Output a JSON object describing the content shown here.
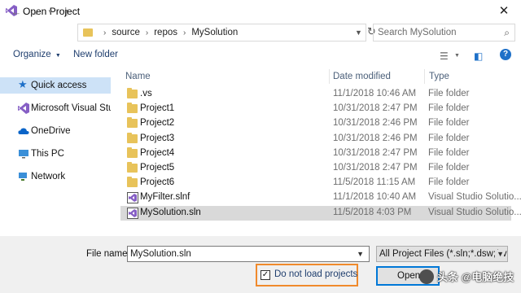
{
  "window": {
    "title": "Open Project"
  },
  "nav": {
    "breadcrumbs": [
      "source",
      "repos",
      "MySolution"
    ],
    "search_placeholder": "Search MySolution"
  },
  "toolbar": {
    "organize_label": "Organize",
    "new_folder_label": "New folder"
  },
  "sidebar": {
    "items": [
      {
        "label": "Quick access",
        "icon": "star-icon",
        "selected": true
      },
      {
        "label": "Microsoft Visual Stud",
        "icon": "visual-studio-icon",
        "selected": false
      },
      {
        "label": "OneDrive",
        "icon": "cloud-icon",
        "selected": false
      },
      {
        "label": "This PC",
        "icon": "computer-icon",
        "selected": false
      },
      {
        "label": "Network",
        "icon": "network-icon",
        "selected": false
      }
    ]
  },
  "columns": {
    "name": "Name",
    "date": "Date modified",
    "type": "Type"
  },
  "files": [
    {
      "name": ".vs",
      "date": "11/1/2018 10:46 AM",
      "type": "File folder",
      "icon": "folder-icon"
    },
    {
      "name": "Project1",
      "date": "10/31/2018 2:47 PM",
      "type": "File folder",
      "icon": "folder-icon"
    },
    {
      "name": "Project2",
      "date": "10/31/2018 2:46 PM",
      "type": "File folder",
      "icon": "folder-icon"
    },
    {
      "name": "Project3",
      "date": "10/31/2018 2:46 PM",
      "type": "File folder",
      "icon": "folder-icon"
    },
    {
      "name": "Project4",
      "date": "10/31/2018 2:47 PM",
      "type": "File folder",
      "icon": "folder-icon"
    },
    {
      "name": "Project5",
      "date": "10/31/2018 2:47 PM",
      "type": "File folder",
      "icon": "folder-icon"
    },
    {
      "name": "Project6",
      "date": "11/5/2018 11:15 AM",
      "type": "File folder",
      "icon": "folder-icon"
    },
    {
      "name": "MyFilter.slnf",
      "date": "11/1/2018 10:40 AM",
      "type": "Visual Studio Solutio...",
      "icon": "solution-file-icon"
    },
    {
      "name": "MySolution.sln",
      "date": "11/5/2018 4:03 PM",
      "type": "Visual Studio Solutio...",
      "icon": "solution-file-icon",
      "selected": true
    }
  ],
  "bottom": {
    "file_name_label": "File name:",
    "file_name_value": "MySolution.sln",
    "filter_value": "All Project Files (*.sln;*.dsw;*.vcw",
    "checkbox_label": "Do not load projects",
    "checkbox_checked": true,
    "open_label": "Open"
  },
  "watermark": {
    "text": "头条 @电脑绝技"
  },
  "colors": {
    "accent": "#0078d7",
    "highlight": "#f08a2c",
    "selection": "#cde2f7"
  }
}
